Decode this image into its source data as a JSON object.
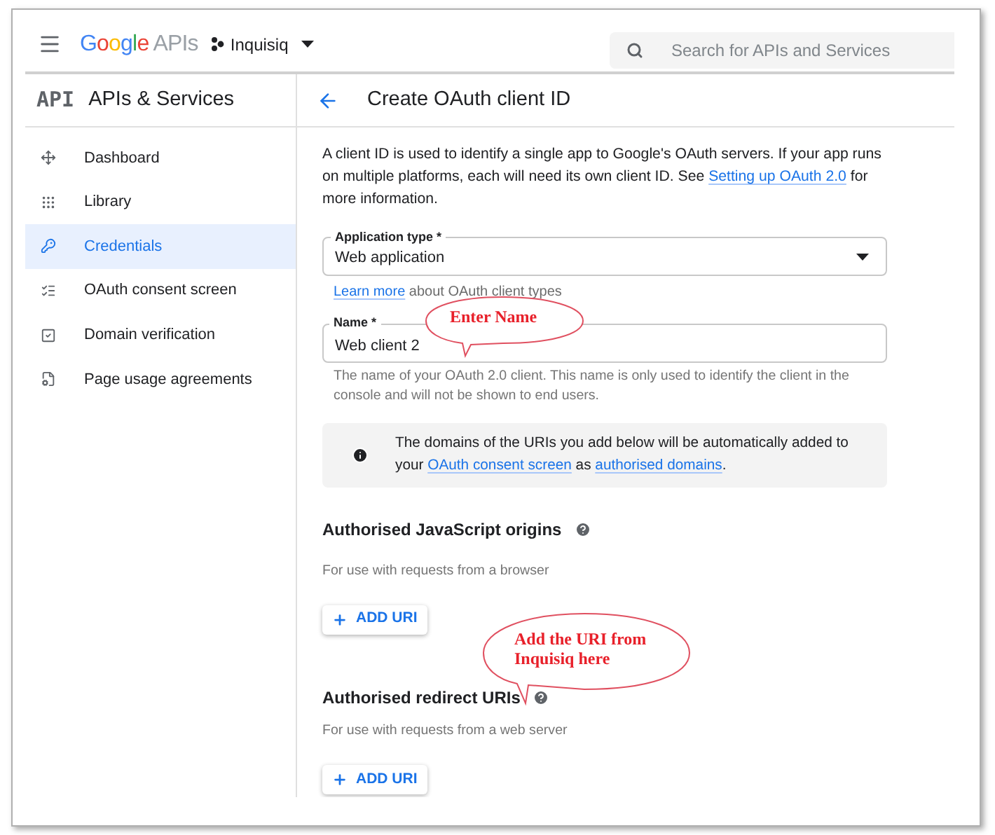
{
  "header": {
    "logo_brand": "Google",
    "logo_suffix": "APIs",
    "project": "Inquisiq",
    "search": {
      "placeholder": "Search for APIs and Services"
    }
  },
  "sidebar": {
    "logo": "API",
    "title": "APIs & Services",
    "items": [
      {
        "label": "Dashboard",
        "selected": false
      },
      {
        "label": "Library",
        "selected": false
      },
      {
        "label": "Credentials",
        "selected": true
      },
      {
        "label": "OAuth consent screen",
        "selected": false
      },
      {
        "label": "Domain verification",
        "selected": false
      },
      {
        "label": "Page usage agreements",
        "selected": false
      }
    ]
  },
  "page": {
    "title": "Create OAuth client ID",
    "intro": [
      {
        "kind": "text",
        "text": "A client ID is used to identify a single app to Google's OAuth servers. If your app runs on multiple platforms, each will need its own client ID. See "
      },
      {
        "kind": "link",
        "text": "Setting up OAuth 2.0"
      },
      {
        "kind": "text",
        "text": " for more information."
      }
    ],
    "application_type": {
      "label": "Application type *",
      "value": "Web application"
    },
    "learn_more": [
      {
        "kind": "link",
        "text": "Learn more"
      },
      {
        "kind": "text",
        "text": " about OAuth client types"
      }
    ],
    "name": {
      "label": "Name *",
      "value": "Web client 2",
      "hint": "The name of your OAuth 2.0 client. This name is only used to identify the client in the console and will not be shown to end users."
    },
    "info": [
      {
        "kind": "text",
        "text": "The domains of the URIs you add below will be automatically added to your "
      },
      {
        "kind": "link",
        "text": "OAuth consent screen"
      },
      {
        "kind": "text",
        "text": " as "
      },
      {
        "kind": "link",
        "text": "authorised domains"
      },
      {
        "kind": "text",
        "text": "."
      }
    ],
    "sections": [
      {
        "heading": "Authorised JavaScript origins",
        "description": "For use with requests from a browser",
        "button": "ADD URI"
      },
      {
        "heading": "Authorised redirect URIs",
        "description": "For use with requests from a web server",
        "button": "ADD URI"
      }
    ]
  },
  "annotations": [
    {
      "text": "Enter Name"
    },
    {
      "text": "Add the URI from Inquisiq here"
    }
  ]
}
